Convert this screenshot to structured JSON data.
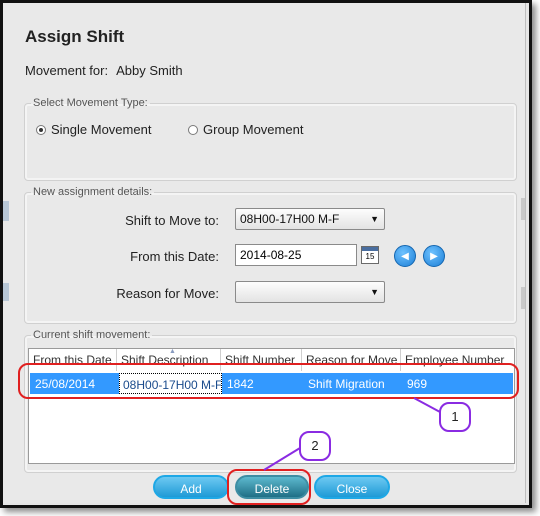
{
  "dialog": {
    "title": "Assign Shift",
    "movement_for_label": "Movement for:",
    "movement_for_name": "Abby Smith"
  },
  "movement_type": {
    "legend": "Select Movement Type:",
    "options": [
      {
        "label": "Single Movement",
        "selected": true
      },
      {
        "label": "Group Movement",
        "selected": false
      }
    ]
  },
  "assignment": {
    "legend": "New assignment details:",
    "shift_label": "Shift to Move to:",
    "shift_value": "08H00-17H00 M-F",
    "date_label": "From this Date:",
    "date_value": "2014-08-25",
    "calendar_day": "15",
    "reason_label": "Reason for Move:",
    "reason_value": ""
  },
  "current": {
    "legend": "Current shift movement:",
    "columns": [
      "From this Date",
      "Shift Description",
      "Shift Number",
      "Reason for Move",
      "Employee Number"
    ],
    "rows": [
      [
        "25/08/2014",
        "08H00-17H00 M-F",
        "1842",
        "Shift Migration",
        "969"
      ]
    ]
  },
  "buttons": {
    "add": "Add",
    "delete": "Delete",
    "close": "Close"
  },
  "annotations": {
    "one": "1",
    "two": "2"
  },
  "colors": {
    "selected_row": "#3399ff",
    "highlight_oval": "#e02020",
    "callout": "#8a2be2"
  }
}
